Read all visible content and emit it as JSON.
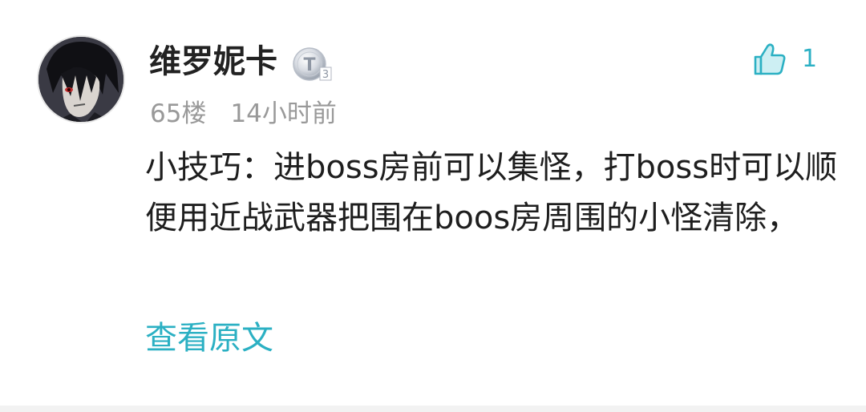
{
  "comment": {
    "username": "维罗妮卡",
    "level_badge": "T3",
    "floor": "65楼",
    "time": "14小时前",
    "likes": "1",
    "content": "小技巧：进boss房前可以集怪，打boss时可以顺便用近战武器把围在boos房周围的小怪清除，",
    "view_original": "查看原文"
  },
  "icons": {
    "like": "thumbs-up-icon",
    "badge": "level-badge-icon",
    "avatar": "avatar"
  },
  "colors": {
    "accent": "#2bb0c3",
    "meta_text": "#999999",
    "body_text": "#1e1e1e"
  }
}
